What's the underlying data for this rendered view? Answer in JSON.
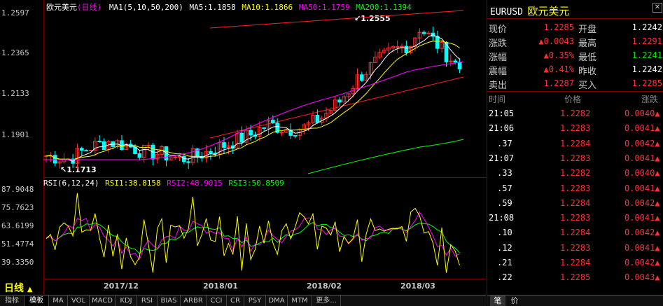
{
  "chart": {
    "title": "欧元美元",
    "period": "(日线)",
    "ma_legend": {
      "ma1": "MA1(5,10,50,200)",
      "ma5": "MA5:1.1858",
      "ma10": "MA10:1.1866",
      "ma50": "MA50:1.1759",
      "ma200": "MA200:1.1394"
    },
    "price_axis": [
      "1.2597",
      "1.2365",
      "1.2133",
      "1.1901"
    ],
    "high_label": "1.2555",
    "low_label": "1.1713",
    "rsi_legend": {
      "rsi": "RSI(6,12,24)",
      "rsi1": "RSI1:38.8158",
      "rsi2": "RSI2:48.9015",
      "rsi3": "RSI3:50.8509"
    },
    "rsi_axis": [
      "87.9048",
      "75.7623",
      "63.6199",
      "51.4774",
      "39.3350"
    ],
    "x_labels": [
      "2017/12",
      "2018/01",
      "2018/02",
      "2018/03"
    ],
    "period_selector": "日线",
    "colors": {
      "up": "#ff3030",
      "down": "#00ffff",
      "ma5": "#ffffff",
      "ma10": "#ffff00",
      "ma50": "#ff00ff",
      "ma200": "#00ff00",
      "rsi1": "#ffff00",
      "rsi2": "#ff00ff",
      "rsi3": "#00ff00",
      "trendline": "#ff2020"
    }
  },
  "tabs": [
    "指标",
    "模板",
    "MA",
    "VOL",
    "MACD",
    "KDJ",
    "RSI",
    "BIAS",
    "ARBR",
    "CCI",
    "CR",
    "PSY",
    "DMA",
    "MTM",
    "更多..."
  ],
  "quote": {
    "symbol": "EURUSD",
    "name": "欧元美元",
    "rows": [
      {
        "l1": "现价",
        "v1": "1.2285",
        "c1": "red",
        "l2": "开盘",
        "v2": "1.2242",
        "c2": "white"
      },
      {
        "l1": "涨跌",
        "v1": "▲0.0043",
        "c1": "red",
        "l2": "最高",
        "v2": "1.2291",
        "c2": "red"
      },
      {
        "l1": "涨幅",
        "v1": "▲0.35%",
        "c1": "red",
        "l2": "最低",
        "v2": "1.2241",
        "c2": "green"
      },
      {
        "l1": "震幅",
        "v1": "▲0.41%",
        "c1": "red",
        "l2": "昨收",
        "v2": "1.2242",
        "c2": "white"
      },
      {
        "l1": "卖出",
        "v1": "1.2287",
        "c1": "red",
        "l2": "买入",
        "v2": "1.2285",
        "c2": "red"
      }
    ]
  },
  "ticks": {
    "headers": [
      "时间",
      "价格",
      "涨跌"
    ],
    "rows": [
      {
        "time": "21:05",
        "price": "1.2282",
        "change": "0.0040▲"
      },
      {
        "time": "21:06",
        "price": "1.2283",
        "change": "0.0041▲"
      },
      {
        "time": ".37",
        "price": "1.2284",
        "change": "0.0042▲"
      },
      {
        "time": "21:07",
        "price": "1.2283",
        "change": "0.0041▲"
      },
      {
        "time": ".33",
        "price": "1.2282",
        "change": "0.0040▲"
      },
      {
        "time": ".57",
        "price": "1.2283",
        "change": "0.0041▲"
      },
      {
        "time": ".59",
        "price": "1.2284",
        "change": "0.0042▲"
      },
      {
        "time": "21:08",
        "price": "1.2283",
        "change": "0.0041▲"
      },
      {
        "time": ".10",
        "price": "1.2284",
        "change": "0.0042▲"
      },
      {
        "time": ".12",
        "price": "1.2283",
        "change": "0.0041▲"
      },
      {
        "time": ".21",
        "price": "1.2284",
        "change": "0.0042▲"
      },
      {
        "time": ".22",
        "price": "1.2285",
        "change": "0.0043▲"
      }
    ]
  },
  "footer_tabs": [
    "笔",
    "价"
  ]
}
